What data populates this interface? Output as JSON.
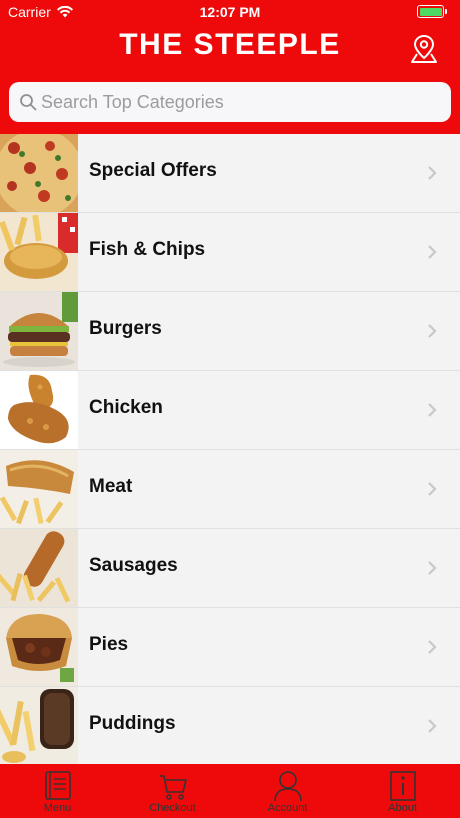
{
  "status_bar": {
    "carrier": "Carrier",
    "time": "12:07 PM"
  },
  "header": {
    "title": "THE STEEPLE"
  },
  "search": {
    "placeholder": "Search Top Categories"
  },
  "categories": [
    {
      "label": "Special Offers"
    },
    {
      "label": "Fish & Chips"
    },
    {
      "label": "Burgers"
    },
    {
      "label": "Chicken"
    },
    {
      "label": "Meat"
    },
    {
      "label": "Sausages"
    },
    {
      "label": "Pies"
    },
    {
      "label": "Puddings"
    }
  ],
  "tabs": [
    {
      "label": "Menu",
      "icon": "menu-book-icon"
    },
    {
      "label": "Checkout",
      "icon": "cart-icon"
    },
    {
      "label": "Account",
      "icon": "person-icon"
    },
    {
      "label": "About",
      "icon": "info-icon"
    }
  ],
  "colors": {
    "brand_red": "#ee0a0a",
    "list_bg": "#f3f3f3",
    "battery_green": "#4cd964"
  }
}
